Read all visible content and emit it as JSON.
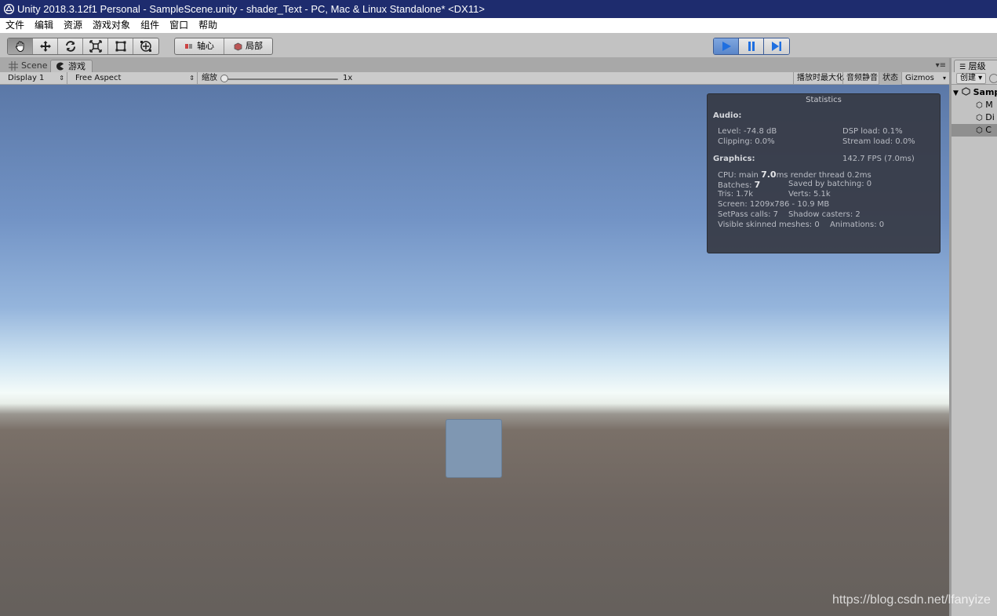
{
  "window": {
    "title": "Unity 2018.3.12f1 Personal - SampleScene.unity - shader_Text - PC, Mac & Linux Standalone* <DX11>"
  },
  "menu": [
    "文件",
    "编辑",
    "资源",
    "游戏对象",
    "组件",
    "窗口",
    "帮助"
  ],
  "toolbar": {
    "tools": [
      "hand-icon",
      "move-icon",
      "rotate-icon",
      "scale-icon",
      "rect-icon",
      "transform-icon"
    ],
    "pivot_label": "轴心",
    "local_label": "局部",
    "play_controls": [
      "play-icon",
      "pause-icon",
      "step-icon"
    ]
  },
  "tabs": {
    "scene": "Scene",
    "game": "游戏"
  },
  "gamebar": {
    "display": "Display 1",
    "aspect": "Free Aspect",
    "scale_label": "缩放",
    "scale_value": "1x",
    "scale_fraction": 0.0,
    "maximize_on_play": "播放时最大化",
    "mute_audio": "音频静音",
    "stats": "状态",
    "gizmos": "Gizmos"
  },
  "stats": {
    "title": "Statistics",
    "audio_header": "Audio:",
    "level": "Level: -74.8 dB",
    "clipping": "Clipping: 0.0%",
    "dsp_load": "DSP load: 0.1%",
    "stream_load": "Stream load: 0.0%",
    "graphics_header": "Graphics:",
    "fps": "142.7 FPS (7.0ms)",
    "cpu_prefix": "CPU: main",
    "cpu_main": "7.0",
    "cpu_suffix": "ms  render thread 0.2ms",
    "batches_prefix": "Batches:",
    "batches": "7",
    "saved_by_batching": "Saved by batching: 0",
    "tris": "Tris: 1.7k",
    "verts": "Verts: 5.1k",
    "screen": "Screen: 1209x786 - 10.9 MB",
    "setpass": "SetPass calls: 7",
    "shadow_casters": "Shadow casters: 2",
    "visible_skinned": "Visible skinned meshes: 0",
    "animations": "Animations: 0"
  },
  "hierarchy": {
    "tab_label": "层级",
    "create_label": "创建",
    "scene_root": "Samp",
    "items": [
      "M",
      "Di",
      "C"
    ]
  },
  "watermark": "https://blog.csdn.net/lfanyize",
  "colors": {
    "title_bar": "#1e2c6e",
    "play_active": "#5a86c9",
    "cube": "#7f97b2"
  }
}
